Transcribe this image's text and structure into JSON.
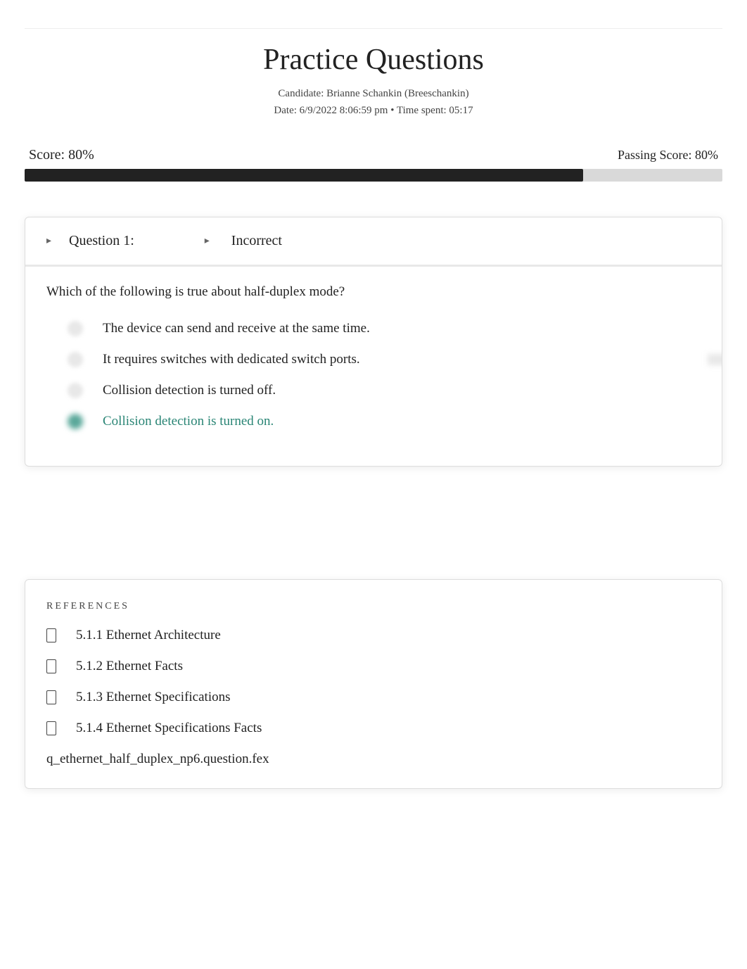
{
  "header": {
    "title": "Practice Questions",
    "candidate_line": "Candidate: Brianne Schankin (Breeschankin)",
    "date_line": "Date: 6/9/2022 8:06:59 pm • Time spent: 05:17"
  },
  "score": {
    "label": "Score: 80%",
    "passing": "Passing Score: 80%",
    "percent": 80
  },
  "question": {
    "number_label": "Question 1:",
    "status": "Incorrect",
    "text": "Which of the following is true about half-duplex mode?",
    "options": [
      {
        "text": "The device can send and receive at the same time.",
        "correct": false,
        "selected": false
      },
      {
        "text": "It requires switches with dedicated switch ports.",
        "correct": false,
        "selected": true
      },
      {
        "text": "Collision detection is turned off.",
        "correct": false,
        "selected": false
      },
      {
        "text": "Collision detection is turned on.",
        "correct": true,
        "selected": false
      }
    ]
  },
  "references": {
    "title": "REFERENCES",
    "items": [
      "5.1.1 Ethernet Architecture",
      "5.1.2 Ethernet Facts",
      "5.1.3 Ethernet Specifications",
      "5.1.4 Ethernet Specifications Facts"
    ],
    "file_id": "q_ethernet_half_duplex_np6.question.fex"
  }
}
